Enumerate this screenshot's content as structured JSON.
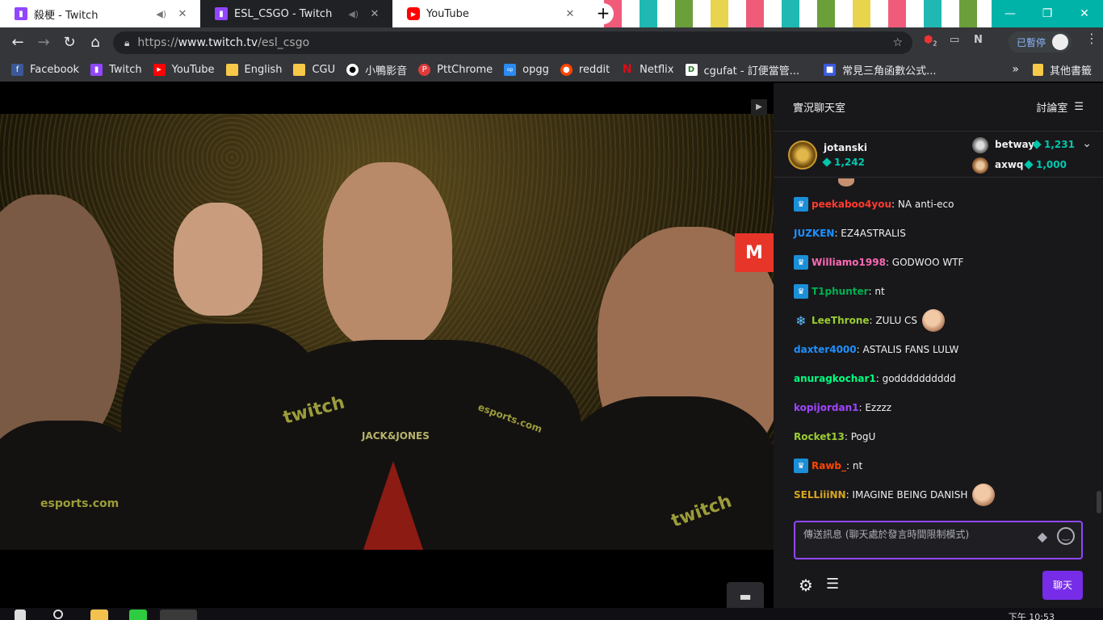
{
  "tabs": [
    {
      "title": "殺梗 - Twitch",
      "favicon": "twitch-icon",
      "audio": true
    },
    {
      "title": "ESL_CSGO - Twitch",
      "favicon": "twitch-icon",
      "audio": true,
      "active": true
    },
    {
      "title": "YouTube",
      "favicon": "youtube-icon"
    }
  ],
  "toolbar": {
    "url_scheme": "https://",
    "url_host": "www.twitch.tv",
    "url_path": "/esl_csgo",
    "extension_badge": "2",
    "paused_label": "已暫停"
  },
  "bookmarks": [
    {
      "label": "Facebook",
      "icon": "facebook-icon",
      "color": "#3b5998"
    },
    {
      "label": "Twitch",
      "icon": "twitch-icon",
      "color": "#9146ff"
    },
    {
      "label": "YouTube",
      "icon": "youtube-icon",
      "color": "#ff0000"
    },
    {
      "label": "English",
      "icon": "folder-icon",
      "color": "#f7c948"
    },
    {
      "label": "CGU",
      "icon": "folder-icon",
      "color": "#f7c948"
    },
    {
      "label": "小鴨影音",
      "icon": "duck-icon",
      "color": "#ffffff"
    },
    {
      "label": "PttChrome",
      "icon": "ptt-icon",
      "color": "#e03b3b"
    },
    {
      "label": "opgg",
      "icon": "opgg-icon",
      "color": "#2a8bf2"
    },
    {
      "label": "reddit",
      "icon": "reddit-icon",
      "color": "#ff4500"
    },
    {
      "label": "Netflix",
      "icon": "netflix-icon",
      "color": "#e50914"
    },
    {
      "label": "cgufat - 訂便當管...",
      "icon": "d-icon",
      "color": "#2e7d32"
    },
    {
      "label": "常見三角函數公式...",
      "icon": "cube-icon",
      "color": "#3b5bdb"
    }
  ],
  "other_bookmarks": "其他書籤",
  "chat": {
    "header_title": "實況聊天室",
    "mode_label": "討論室",
    "leaderboard": {
      "top": {
        "name": "jotanski",
        "points": "1,242"
      },
      "second": {
        "name": "betway",
        "points": "1,231"
      },
      "third": {
        "name": "axwq",
        "points": "1,000"
      }
    },
    "messages": [
      {
        "user": "peekaboo4you",
        "color": "#ff3a2e",
        "text": ": NA anti-eco",
        "badge": "crown"
      },
      {
        "user": "JUZKEN",
        "color": "#1e90ff",
        "text": ": EZ4ASTRALIS",
        "badge": ""
      },
      {
        "user": "Williamo1998",
        "color": "#ff69b4",
        "text": ": GODWOO WTF",
        "badge": "crown"
      },
      {
        "user": "T1phunter",
        "color": "#00b050",
        "text": ": nt",
        "badge": "crown"
      },
      {
        "user": "LeeThrone",
        "color": "#9acd32",
        "text": ": ZULU CS",
        "badge": "snow",
        "emote": true
      },
      {
        "user": "daxter4000",
        "color": "#1e90ff",
        "text": ": ASTALIS FANS LULW",
        "badge": ""
      },
      {
        "user": "anuragkochar1",
        "color": "#00ff7f",
        "text": ": godddddddddd",
        "badge": ""
      },
      {
        "user": "kopijordan1",
        "color": "#a045ff",
        "text": ": Ezzzz",
        "badge": ""
      },
      {
        "user": "Rocket13",
        "color": "#9acd32",
        "text": ": PogU",
        "badge": ""
      },
      {
        "user": "Rawb_",
        "color": "#ff4500",
        "text": ": nt",
        "badge": "crown"
      },
      {
        "user": "SELLiiiNN",
        "color": "#daa520",
        "text": ": IMAGINE BEING DANISH",
        "badge": "",
        "emote": true
      }
    ],
    "input_placeholder": "傳送訊息 (聊天處於發言時間限制模式)",
    "send_label": "聊天"
  },
  "taskbar": {
    "clock": "下午 10:53"
  },
  "colors": {
    "twitch_purple": "#9147ff",
    "chat_bg": "#18181b",
    "chrome_dark": "#35363a"
  }
}
